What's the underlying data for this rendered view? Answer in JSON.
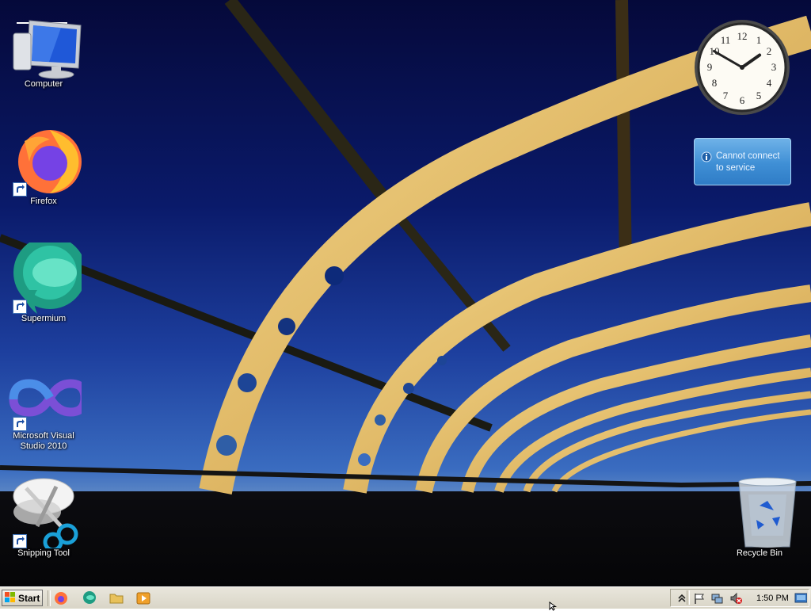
{
  "desktop": {
    "icons": [
      {
        "label": "Computer",
        "icon": "computer-monitor-icon"
      },
      {
        "label": "Firefox",
        "icon": "firefox-icon"
      },
      {
        "label": "Supermium",
        "icon": "supermium-icon"
      },
      {
        "label": "Microsoft Visual Studio 2010",
        "icon": "visual-studio-icon"
      },
      {
        "label": "Snipping Tool",
        "icon": "snipping-tool-icon"
      },
      {
        "label": "Recycle Bin",
        "icon": "recycle-bin-icon"
      }
    ]
  },
  "gadgets": {
    "clock": {
      "hour": 1,
      "minute": 50
    },
    "weather": {
      "message": "Cannot connect to service"
    }
  },
  "taskbar": {
    "start_label": "Start",
    "quick_launch": [
      "firefox-icon",
      "supermium-icon",
      "folder-icon",
      "media-player-icon"
    ],
    "tray_icons": [
      "show-hidden-icons-chevron",
      "action-center-flag-icon",
      "network-icon",
      "volume-muted-icon"
    ],
    "clock_text": "1:50 PM"
  },
  "colors": {
    "taskbar": "#d9d5c7",
    "gadget": "#3f8fd5",
    "sky_top": "#05093a",
    "sky_horizon": "#7a9ec8"
  }
}
